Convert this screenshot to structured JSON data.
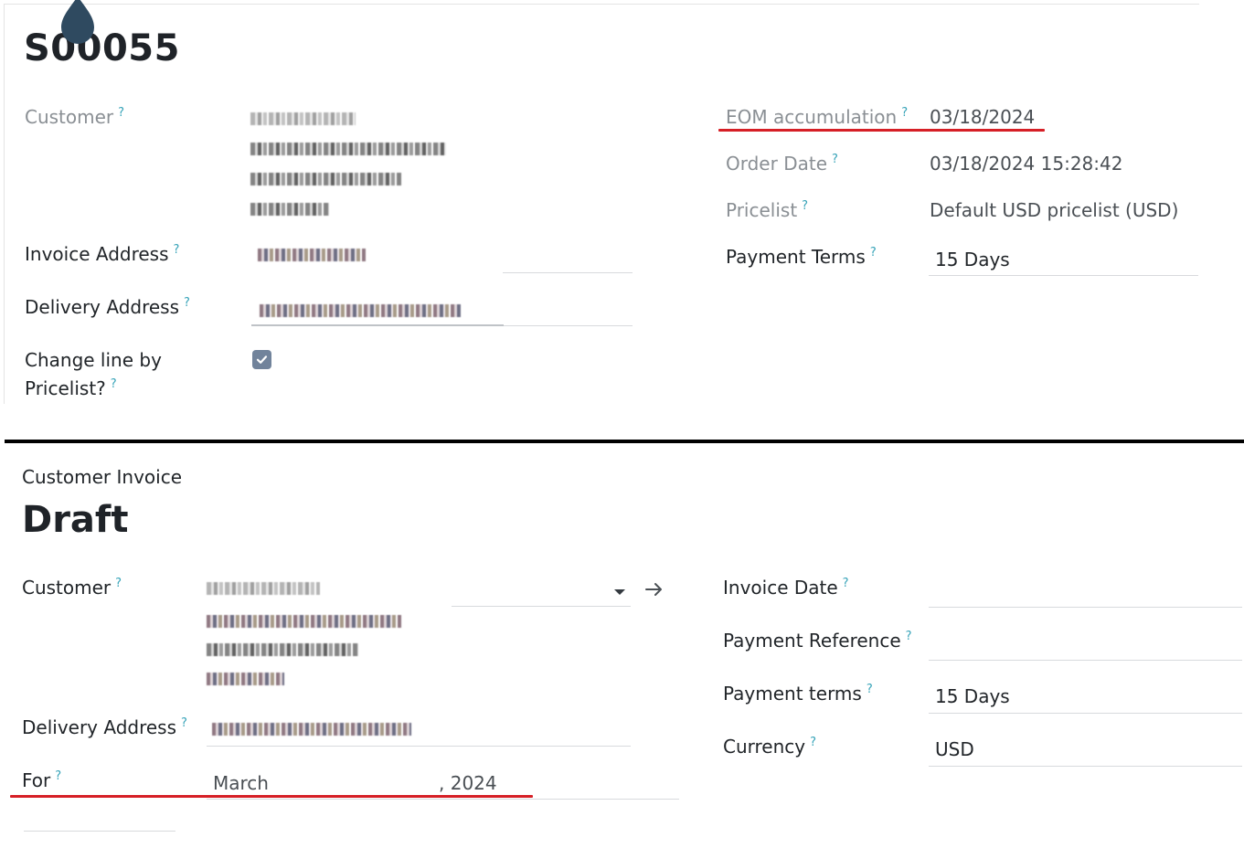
{
  "order": {
    "title": "S00055",
    "fields_left": {
      "customer_label": "Customer",
      "invoice_address_label": "Invoice Address",
      "delivery_address_label": "Delivery Address",
      "change_line_label_1": "Change line by",
      "change_line_label_2": "Pricelist?",
      "change_line_checked": true
    },
    "fields_right": {
      "eom_label": "EOM accumulation",
      "eom_value": "03/18/2024",
      "order_date_label": "Order Date",
      "order_date_value": "03/18/2024 15:28:42",
      "pricelist_label": "Pricelist",
      "pricelist_value": "Default USD pricelist (USD)",
      "payment_terms_label": "Payment Terms",
      "payment_terms_value": "15 Days"
    }
  },
  "invoice": {
    "doc_type": "Customer Invoice",
    "title": "Draft",
    "fields_left": {
      "customer_label": "Customer",
      "delivery_address_label": "Delivery Address",
      "for_label": "For",
      "for_month": "March",
      "for_year": ", 2024"
    },
    "fields_right": {
      "invoice_date_label": "Invoice Date",
      "payment_reference_label": "Payment Reference",
      "payment_terms_label": "Payment terms",
      "payment_terms_value": "15 Days",
      "currency_label": "Currency",
      "currency_value": "USD"
    }
  },
  "help_marker": "?",
  "colors": {
    "highlight": "#d61f26",
    "help": "#36a3b8",
    "checkbox": "#71839b",
    "divider": "#000000"
  },
  "icons": [
    "drop-icon",
    "check-icon",
    "chevron-down-icon",
    "arrow-right-icon"
  ]
}
